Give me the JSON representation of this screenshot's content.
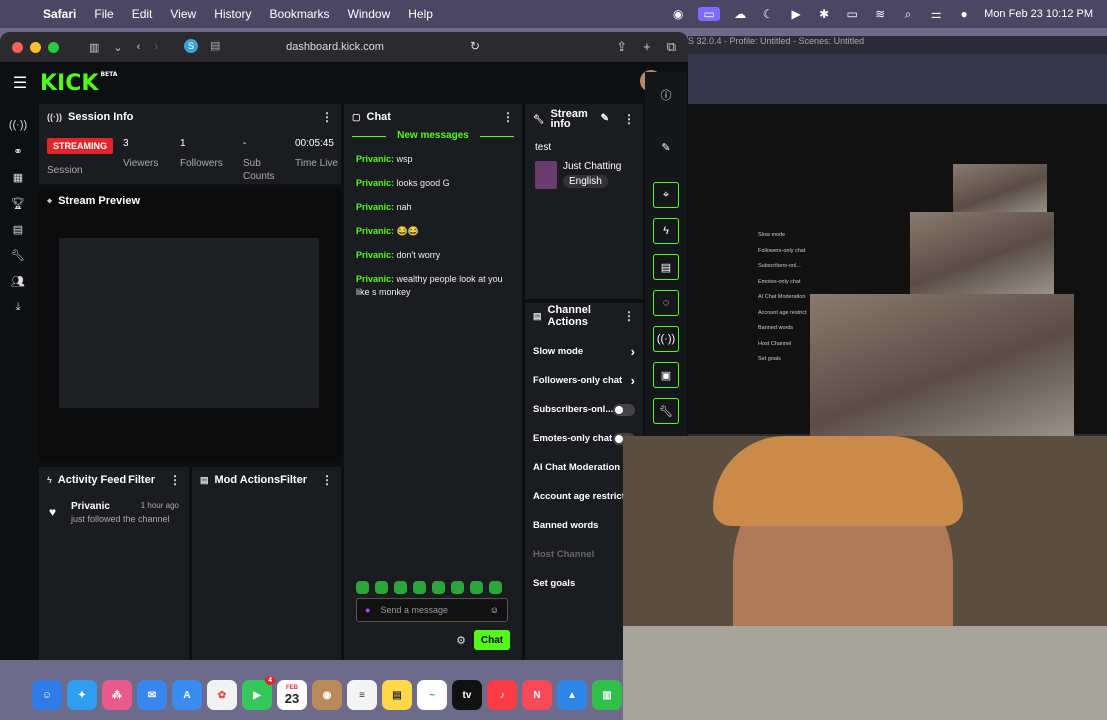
{
  "menubar": {
    "app": "Safari",
    "items": [
      "File",
      "Edit",
      "View",
      "History",
      "Bookmarks",
      "Window",
      "Help"
    ],
    "datetime": "Mon Feb 23  10:12 PM"
  },
  "browser": {
    "url": "dashboard.kick.com"
  },
  "obs_title": "S 32.0.4 - Profile: Untitled - Scenes: Untitled",
  "kick": {
    "logo": "KICK",
    "beta": "BETA"
  },
  "session": {
    "title": "Session Info",
    "status": "STREAMING",
    "status_label": "Session",
    "viewers": "3",
    "viewers_label": "Viewers",
    "followers": "1",
    "followers_label": "Followers",
    "subs": "-",
    "subs_label": "Sub Counts",
    "time": "00:05:45",
    "time_label": "Time Live"
  },
  "preview": {
    "title": "Stream Preview"
  },
  "activity": {
    "title": "Activity Feed",
    "filter": "Filter",
    "items": [
      {
        "user": "Privanic",
        "text": "just followed the channel",
        "time": "1 hour ago"
      }
    ]
  },
  "mod": {
    "title": "Mod Actions",
    "filter": "Filter"
  },
  "chat": {
    "title": "Chat",
    "new_messages": "New messages",
    "messages": [
      {
        "user": "Privanic:",
        "text": "wsp"
      },
      {
        "user": "Privanic:",
        "text": "looks good G"
      },
      {
        "user": "Privanic:",
        "text": "nah"
      },
      {
        "user": "Privanic:",
        "text": "😂😂"
      },
      {
        "user": "Privanic:",
        "text": "don't worry"
      },
      {
        "user": "Privanic:",
        "text": "wealthy people look at you like s monkey"
      }
    ],
    "placeholder": "Send a message",
    "send": "Chat"
  },
  "stream_info": {
    "title": "Stream info",
    "stream_title": "test",
    "category": "Just Chatting",
    "language": "English"
  },
  "channel_actions": {
    "title": "Channel Actions",
    "items": [
      "Slow mode",
      "Followers-only chat",
      "Subscribers-onl...",
      "Emotes-only chat",
      "AI Chat Moderation",
      "Account age restrictic",
      "Banned words",
      "Host Channel",
      "Set goals"
    ]
  },
  "obs_mini_items": [
    "Slow mode",
    "Followers-only chat",
    "Subscribers-onl...",
    "Emotes-only chat",
    "AI Chat Moderation",
    "Account age restrict",
    "Banned words",
    "Host Channel",
    "Set goals"
  ],
  "dock": {
    "badge": "4",
    "calendar_month": "FEB",
    "calendar_day": "23",
    "tv": "tv"
  },
  "colors": {
    "accent": "#53fc18",
    "live": "#e0262a",
    "panel": "#1b1c1f"
  }
}
